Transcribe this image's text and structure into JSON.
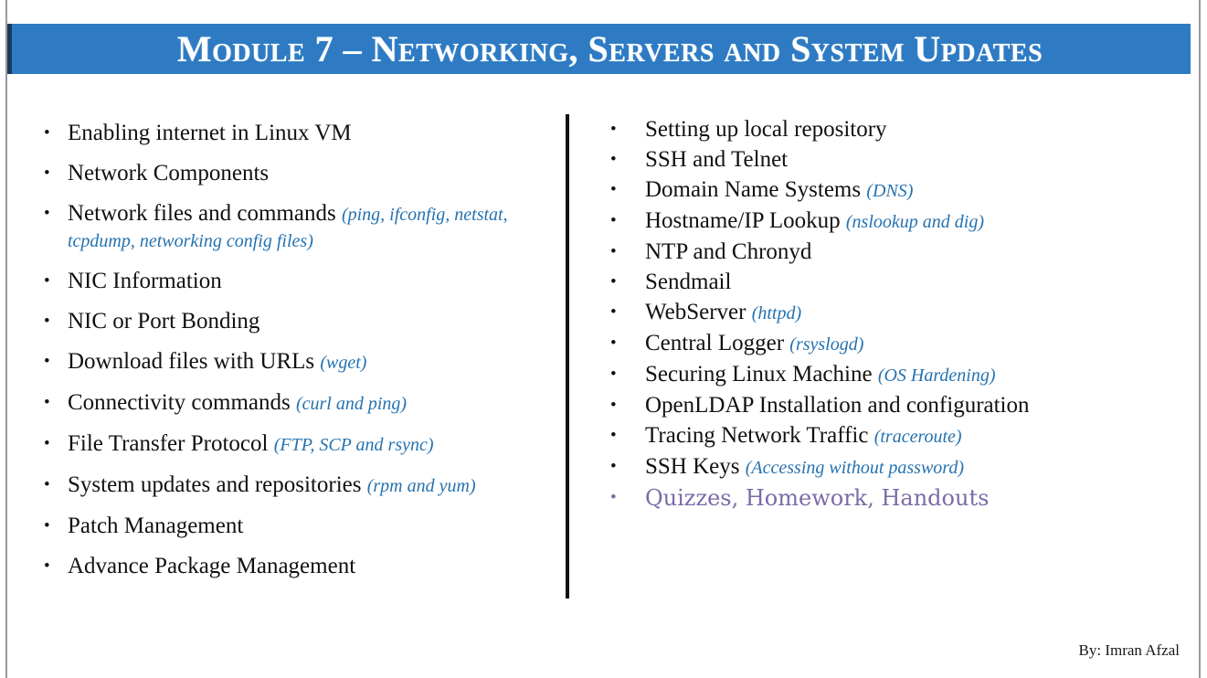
{
  "slide": {
    "title": "Module 7 – Networking, Servers and System Updates",
    "banner_color": "#2E7BC4",
    "note_color": "#2572B0",
    "highlight_color": "#7B6BA8",
    "bullet_glyph": "•"
  },
  "left_column": [
    {
      "text": "Enabling internet in Linux VM",
      "note": ""
    },
    {
      "text": "Network Components",
      "note": ""
    },
    {
      "text": "Network files and commands ",
      "note": "(ping, ifconfig, netstat, tcpdump, networking config files)"
    },
    {
      "text": "NIC Information",
      "note": ""
    },
    {
      "text": "NIC or Port Bonding",
      "note": ""
    },
    {
      "text": "Download files with URLs ",
      "note": "(wget)"
    },
    {
      "text": "Connectivity commands ",
      "note": "(curl and ping)"
    },
    {
      "text": "File Transfer Protocol ",
      "note": "(FTP, SCP and rsync)"
    },
    {
      "text": "System updates and repositories ",
      "note": "(rpm and yum)"
    },
    {
      "text": "Patch Management",
      "note": ""
    },
    {
      "text": "Advance Package Management",
      "note": ""
    }
  ],
  "right_column": [
    {
      "text": "Setting up local repository",
      "note": ""
    },
    {
      "text": "SSH and Telnet",
      "note": ""
    },
    {
      "text": "Domain Name Systems ",
      "note": "(DNS)"
    },
    {
      "text": "Hostname/IP Lookup ",
      "note": "(nslookup and dig)"
    },
    {
      "text": "NTP and Chronyd",
      "note": ""
    },
    {
      "text": "Sendmail",
      "note": ""
    },
    {
      "text": "WebServer ",
      "note": "(httpd)"
    },
    {
      "text": "Central Logger ",
      "note": "(rsyslogd)"
    },
    {
      "text": "Securing Linux Machine ",
      "note": "(OS Hardening)"
    },
    {
      "text": "OpenLDAP Installation and configuration",
      "note": ""
    },
    {
      "text": "Tracing Network Traffic ",
      "note": "(traceroute)"
    },
    {
      "text": "SSH Keys ",
      "note": "(Accessing without password)"
    },
    {
      "text": "Quizzes, Homework, Handouts",
      "note": "",
      "highlight": true
    }
  ],
  "footer": {
    "credit": "By: Imran Afzal"
  }
}
